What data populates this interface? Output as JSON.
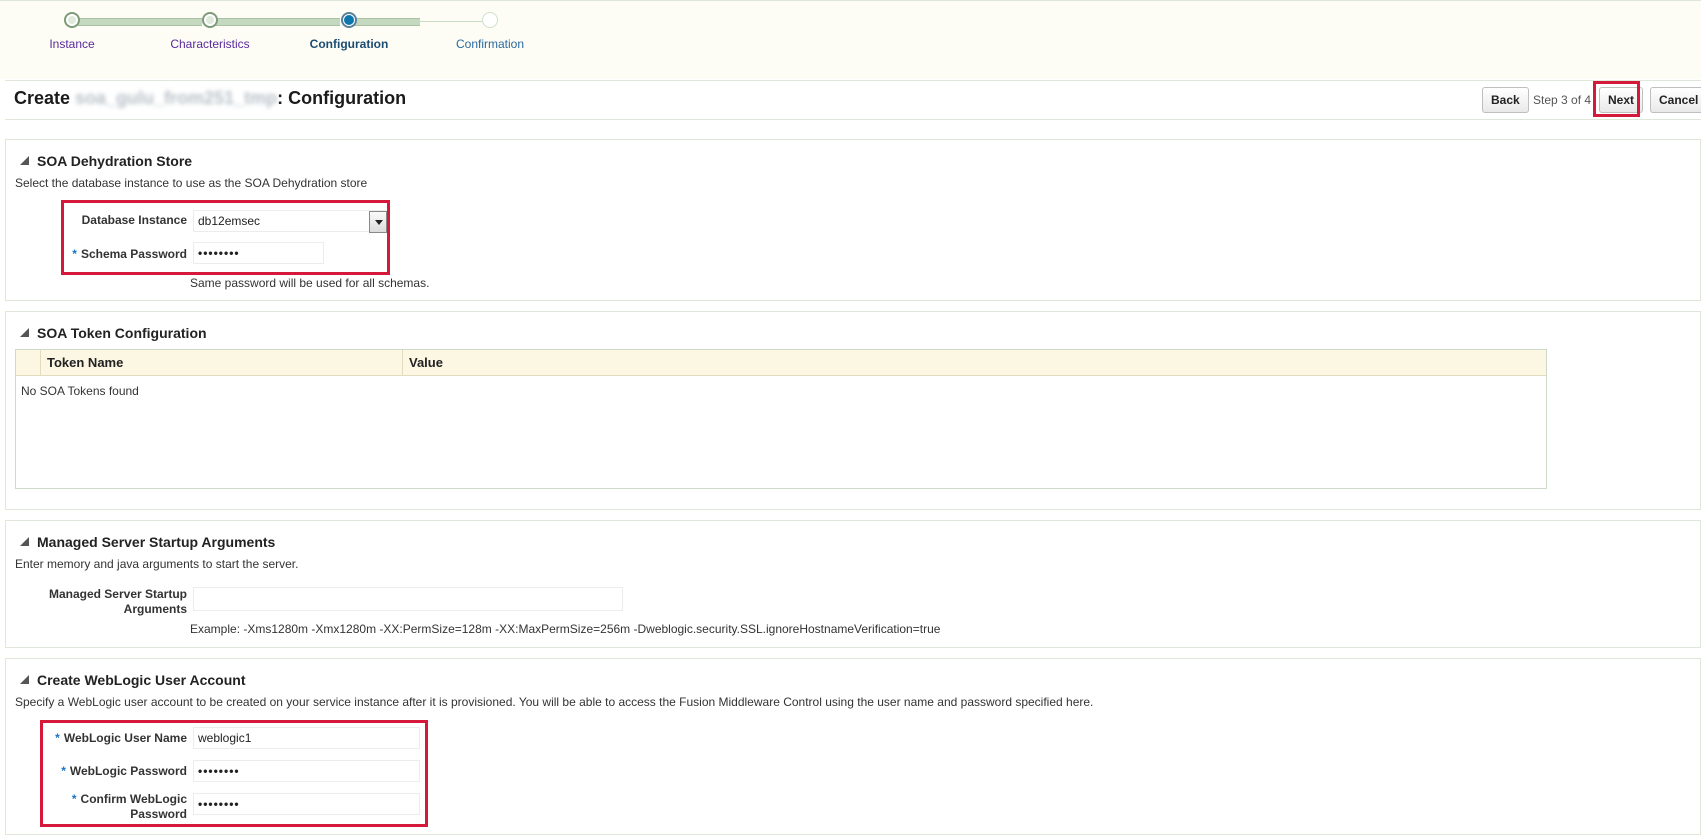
{
  "train": {
    "steps": [
      {
        "label": "Instance",
        "state": "visited"
      },
      {
        "label": "Characteristics",
        "state": "visited"
      },
      {
        "label": "Configuration",
        "state": "current"
      },
      {
        "label": "Confirmation",
        "state": "future"
      }
    ]
  },
  "header": {
    "title_prefix": "Create ",
    "title_obscured": "soa_gulu_from251_tmp",
    "title_suffix": ": Configuration",
    "back_label": "Back",
    "step_text": "Step 3 of 4",
    "next_label": "Next",
    "cancel_label": "Cancel"
  },
  "dehydration": {
    "heading": "SOA Dehydration Store",
    "description": "Select the database instance to use as the SOA Dehydration store",
    "db_label": "Database Instance",
    "db_value": "db12emsec",
    "schema_label": "Schema Password",
    "schema_value": "••••••••",
    "hint": "Same password will be used for all schemas."
  },
  "tokens": {
    "heading": "SOA Token Configuration",
    "columns": [
      "Token Name",
      "Value"
    ],
    "empty_message": "No SOA Tokens found"
  },
  "startup": {
    "heading": "Managed Server Startup Arguments",
    "description": "Enter memory and java arguments to start the server.",
    "label_line1": "Managed Server Startup",
    "label_line2": "Arguments",
    "value": "",
    "example": "Example: -Xms1280m -Xmx1280m -XX:PermSize=128m -XX:MaxPermSize=256m -Dweblogic.security.SSL.ignoreHostnameVerification=true"
  },
  "weblogic": {
    "heading": "Create WebLogic User Account",
    "description": "Specify a WebLogic user account to be created on your service instance after it is provisioned. You will be able to access the Fusion Middleware Control using the user name and password specified here.",
    "user_label": "WebLogic User Name",
    "user_value": "weblogic1",
    "password_label": "WebLogic Password",
    "password_value": "••••••••",
    "confirm_label_line1": "Confirm WebLogic",
    "confirm_label_line2": "Password",
    "confirm_value": "••••••••"
  },
  "colors": {
    "highlight": "#d4193b",
    "required_star": "#1a73c7",
    "current_step": "#0f76ad"
  }
}
